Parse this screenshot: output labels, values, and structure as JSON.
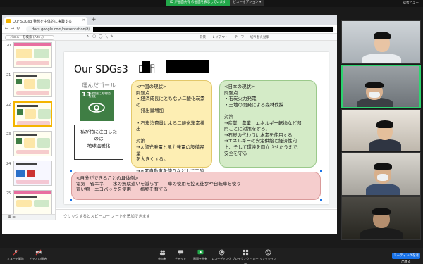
{
  "zoom_top": {
    "share_status": "ID が画面共有 の画面を表示しています",
    "view_options": "ビューオプション ▾",
    "speaker_view": "話者ビュー"
  },
  "browser": {
    "tab_title": "Our SDGs3 発想を主体的に実践する",
    "url": "docs.google.com/presentation/d/"
  },
  "slides_app": {
    "menu_placeholder": "メニューを検索 (Alt+/)",
    "toolbar_items": [
      "背景",
      "レイアウト",
      "テーマ",
      "切り替え効果"
    ],
    "slide_numbers": [
      "20",
      "21",
      "22",
      "23",
      "24",
      "25"
    ],
    "notes_placeholder": "クリックするとスピーカー ノートを追加できます"
  },
  "slide": {
    "title": "Our SDGs3　D組　番",
    "goal_label": "選んだゴール",
    "sdg_number": "13",
    "sdg_text": "気候変動に具体的な対策を",
    "focus_box": "私が特に注目した\nのは\n地球温暖化",
    "china_card": "<中国の現状>\n問題点\n・経済成長にともない二酸化炭素の\n　排出量増加\n\n・石炭消費量による二酸化炭素排出\n\n対策\n→太陽光発電と風力発電の設備容量\nを大きくする。\n\n→水素自動車を使うなどして二酸化\n炭素削減する。石炭消費を減らす",
    "japan_card": "<日本の現状>\n問題点\n・石炭火力発電\n・土地の開発による森林伐採\n\n対策\n→産業　農業　エネルギー転換など部\n門ごとに対策をする。\n→石炭の代わりに水素を使用する\n→エネルギーの安定供給と経済性向\n上、そして環境を両立させたうえで、\n安全を守る",
    "action_card": "<自分ができることの具体例>\n電気　省エネ　　水の無駄遣いを減らす　　車の使用を控え徒歩や自転車を使う\n買い物　エコバックを使用　　植物を育てる"
  },
  "zoom_controls": {
    "items": [
      "ミュート解除",
      "ビデオの開始",
      "参加者",
      "チャット",
      "画面を共有",
      "レコーディング",
      "ブレイクアウト ルーム",
      "リアクション"
    ],
    "participants_count": "5",
    "end_label": "ミーティングを退出する"
  },
  "colors": {
    "china_card": "#fdeeb3",
    "japan_card": "#d4ebc7",
    "action_card": "#f5cdcd",
    "sdg13": "#3f7e44",
    "share_green": "#22a84a",
    "end_blue": "#1a73e8"
  }
}
